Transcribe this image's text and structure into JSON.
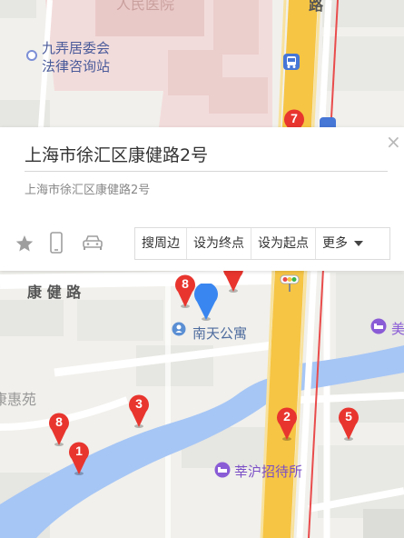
{
  "map": {
    "labels": {
      "top_cut": "人民医院",
      "road_cut": "路",
      "committee_line1": "九弄居委会",
      "committee_line2": "法律咨询站",
      "kangjian_road": "康 健 路",
      "nantian": "南天公寓",
      "huiyuan": "康惠苑",
      "mei": "美",
      "huahu": "莘沪招待所"
    },
    "markers": [
      "1",
      "2",
      "3",
      "5",
      "6",
      "7",
      "8"
    ]
  },
  "card": {
    "title": "上海市徐汇区康健路2号",
    "subtitle": "上海市徐汇区康健路2号",
    "close": "×",
    "actions": {
      "nearby": "搜周边",
      "set_end": "设为终点",
      "set_start": "设为起点",
      "more": "更多"
    }
  },
  "icons": [
    "star-icon",
    "phone-icon",
    "car-icon",
    "close-icon",
    "bus-stop-icon",
    "traffic-light-icon",
    "location-pin-icon",
    "poi-icon",
    "hotel-icon"
  ],
  "colors": {
    "highway": "#f6c544",
    "road_edge": "#e94c4c",
    "river": "#a6c6f5",
    "marker": "#e8352e",
    "pin": "#3a86f0",
    "hospital_area": "#f2dcdb"
  }
}
